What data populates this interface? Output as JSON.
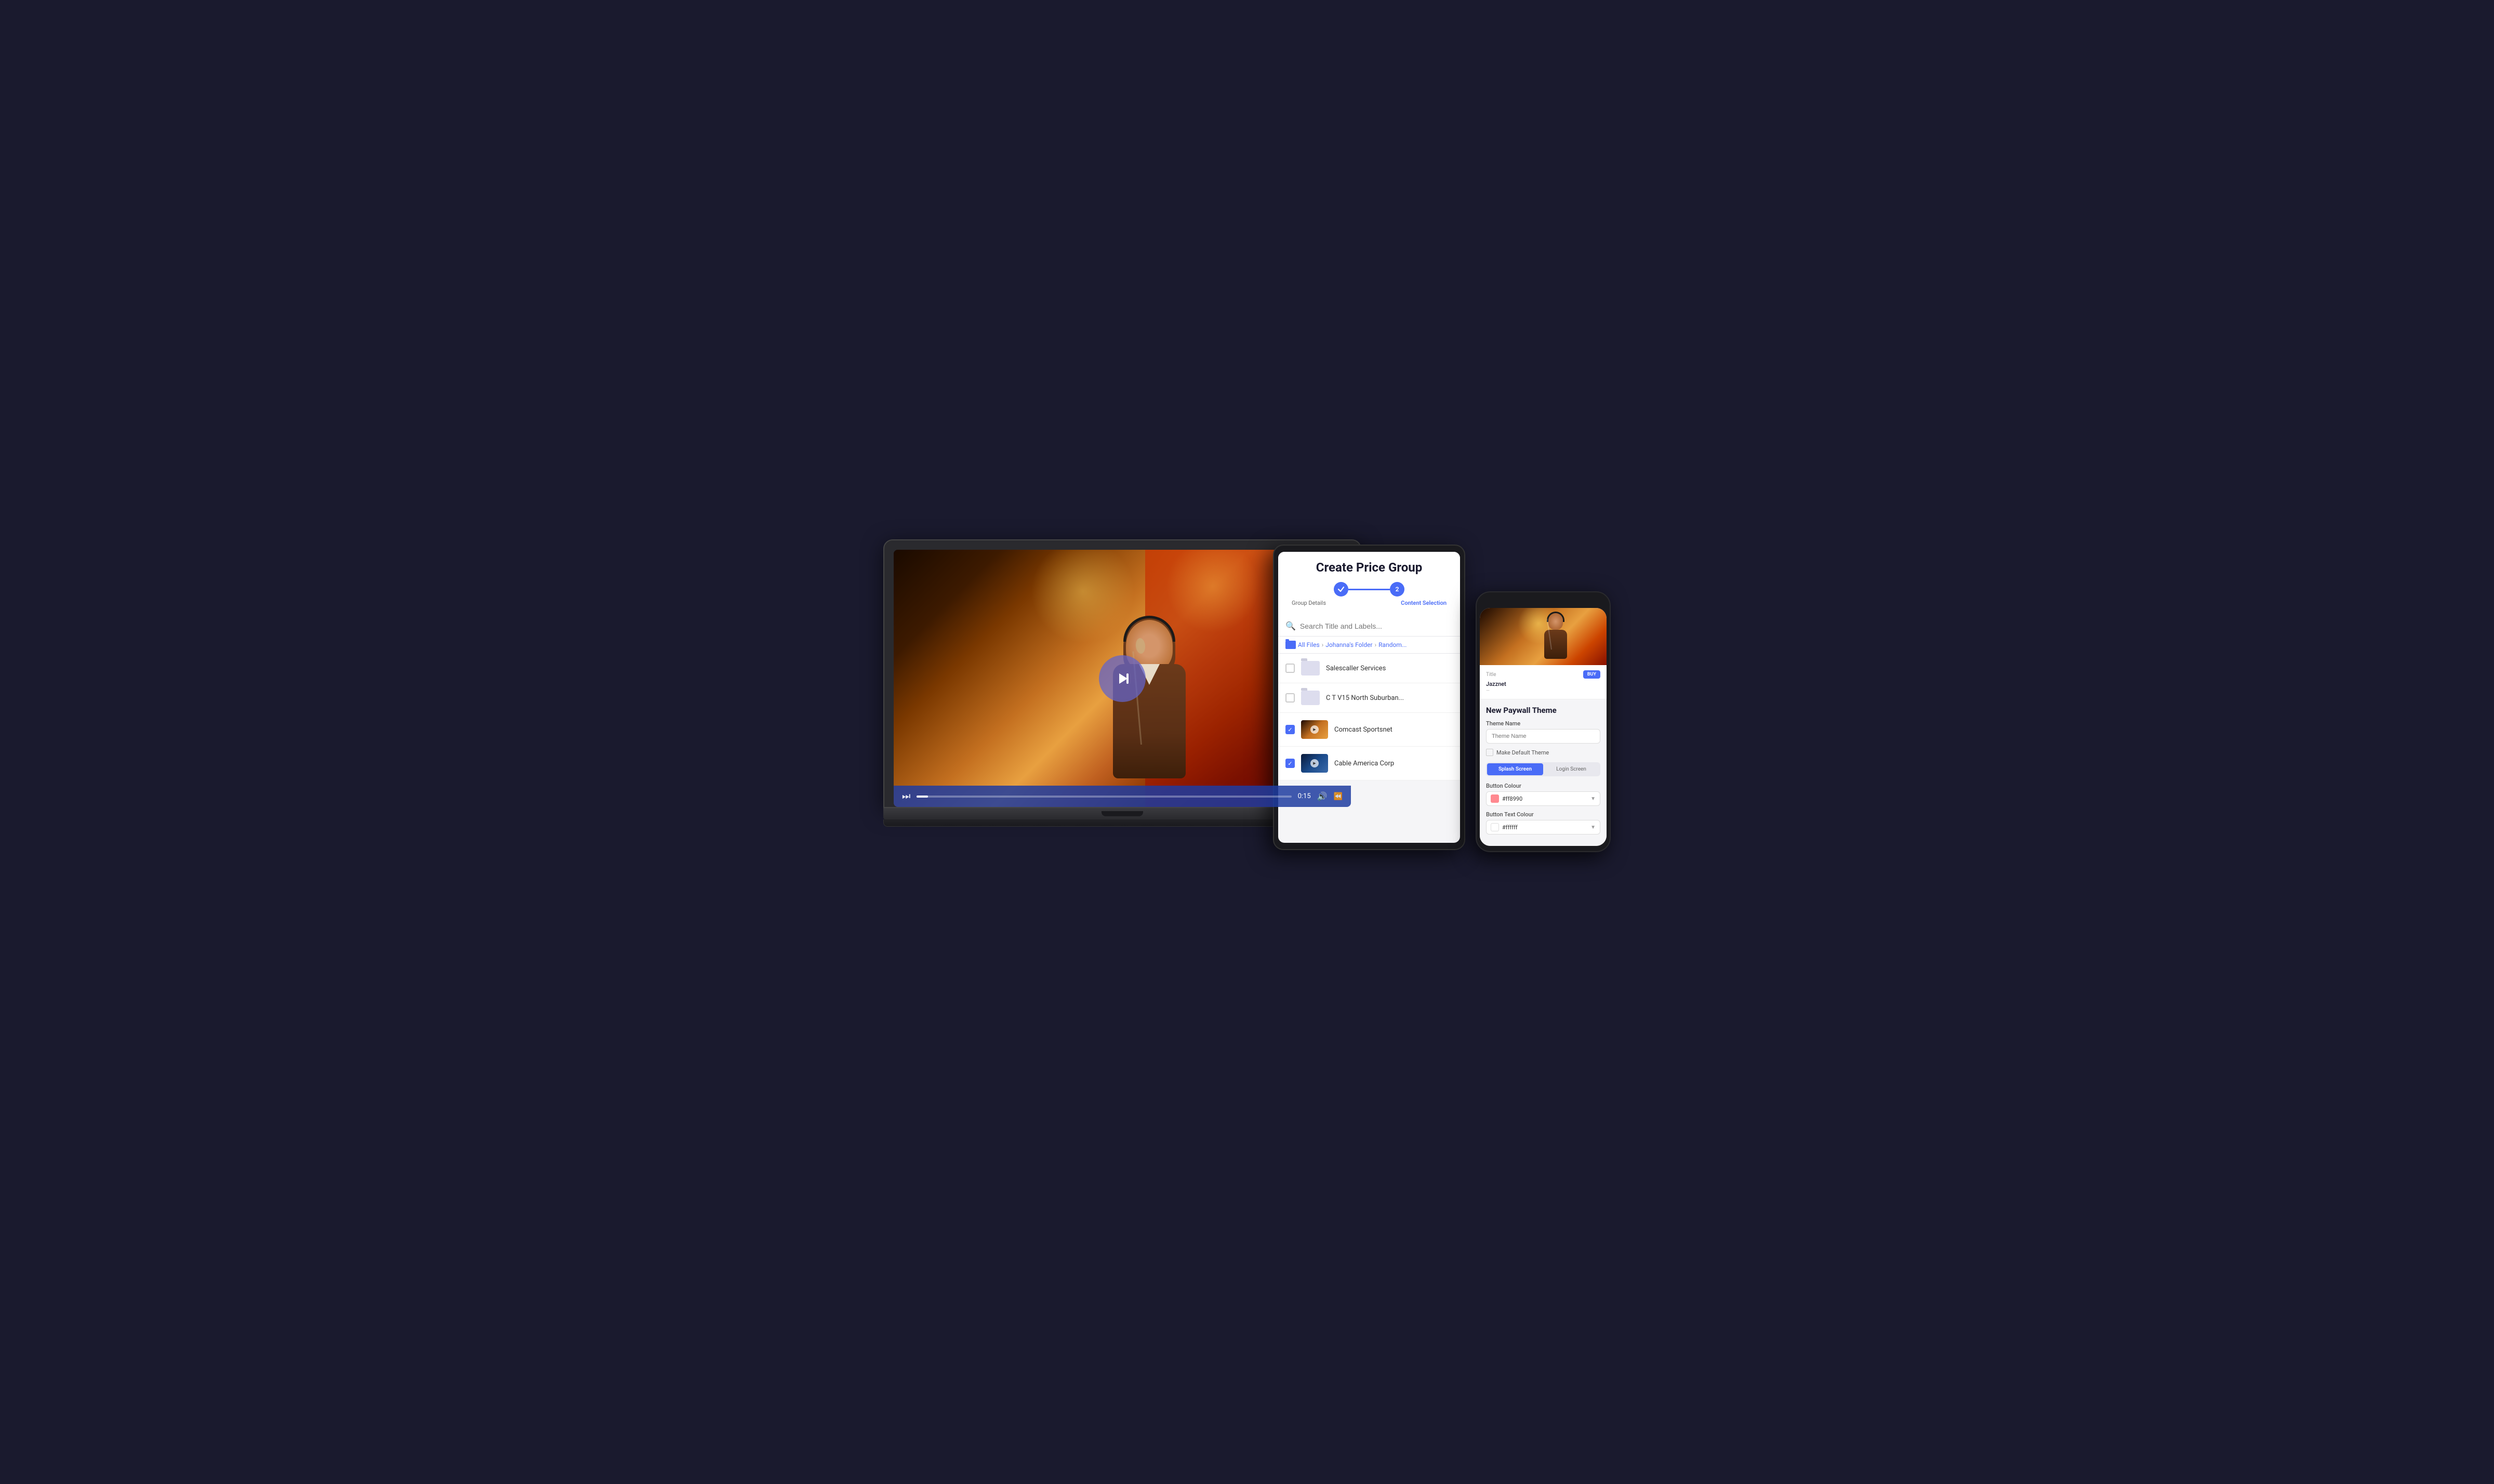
{
  "laptop": {
    "controls": {
      "time": "0:15",
      "play_btn": "⏭",
      "volume_btn": "🔊",
      "rewind_btn": "⏪"
    }
  },
  "tablet": {
    "title": "Create Price Group",
    "stepper": {
      "step1_label": "Group Details",
      "step2_label": "Content Selection"
    },
    "search": {
      "placeholder": "Search Title and Labels..."
    },
    "breadcrumb": {
      "parts": [
        "All Files",
        "Johanna's Folder",
        "Random..."
      ]
    },
    "files": [
      {
        "name": "Salescaller Services",
        "type": "folder",
        "checked": false
      },
      {
        "name": "C T V15 North Suburban...",
        "type": "folder",
        "checked": false
      },
      {
        "name": "Comcast Sportsnet",
        "type": "video",
        "checked": true
      },
      {
        "name": "Cable America Corp",
        "type": "video",
        "checked": true
      }
    ]
  },
  "phone": {
    "paywall": {
      "title_label": "Title",
      "title_value": "Jazznet",
      "buy_btn": "BUY",
      "subtitle": "—"
    },
    "theme": {
      "section_title": "New Paywall Theme",
      "theme_name_label": "Theme Name",
      "theme_name_placeholder": "Theme Name",
      "default_label": "Make Default Theme",
      "tabs": [
        "Splash Screen",
        "Login Screen"
      ],
      "active_tab": 0,
      "button_colour_label": "Button Colour",
      "button_colour_value": "#ff8990",
      "button_text_colour_label": "Button Text Colour",
      "button_text_colour_value": "#ffffff"
    }
  }
}
